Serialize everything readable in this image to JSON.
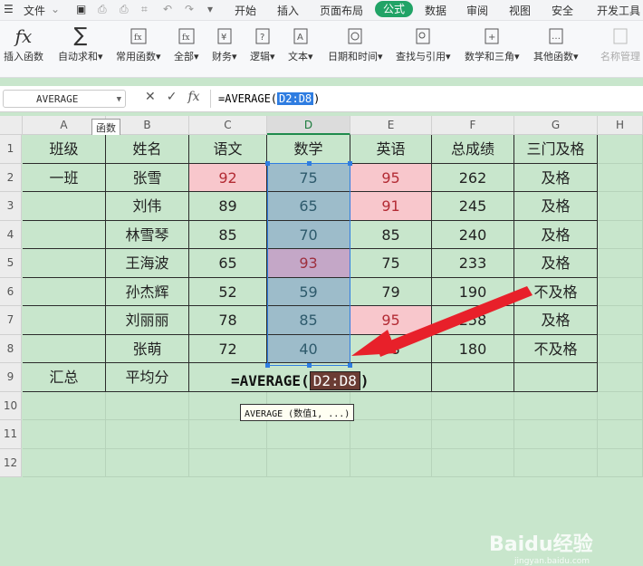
{
  "menubar": {
    "file": "文件",
    "tabs": [
      "开始",
      "插入",
      "页面布局",
      "公式",
      "数据",
      "审阅",
      "视图",
      "安全",
      "开发工具"
    ],
    "active_tab": "公式"
  },
  "ribbon": {
    "buttons": [
      {
        "label": "插入函数"
      },
      {
        "label": "自动求和▾"
      },
      {
        "label": "常用函数▾"
      },
      {
        "label": "全部▾"
      },
      {
        "label": "财务▾"
      },
      {
        "label": "逻辑▾"
      },
      {
        "label": "文本▾"
      },
      {
        "label": "日期和时间▾"
      },
      {
        "label": "查找与引用▾"
      },
      {
        "label": "数学和三角▾"
      },
      {
        "label": "其他函数▾"
      },
      {
        "label": "名称管理"
      }
    ]
  },
  "formula_bar": {
    "name_box": "AVERAGE",
    "fx": "fx",
    "formula_prefix": "=AVERAGE(",
    "formula_ref": "D2:D8",
    "formula_suffix": ")"
  },
  "fx_tooltip": "函数",
  "columns": [
    "A",
    "B",
    "C",
    "D",
    "E",
    "F",
    "G",
    "H"
  ],
  "rows": [
    "1",
    "2",
    "3",
    "4",
    "5",
    "6",
    "7",
    "8",
    "9",
    "10",
    "11",
    "12"
  ],
  "table": {
    "header": [
      "班级",
      "姓名",
      "语文",
      "数学",
      "英语",
      "总成绩",
      "三门及格"
    ],
    "data": [
      [
        "一班",
        "张雪",
        "92",
        "75",
        "95",
        "262",
        "及格"
      ],
      [
        "",
        "刘伟",
        "89",
        "65",
        "91",
        "245",
        "及格"
      ],
      [
        "",
        "林雪琴",
        "85",
        "70",
        "85",
        "240",
        "及格"
      ],
      [
        "",
        "王海波",
        "65",
        "93",
        "75",
        "233",
        "及格"
      ],
      [
        "",
        "孙杰辉",
        "52",
        "59",
        "79",
        "190",
        "不及格"
      ],
      [
        "",
        "刘丽丽",
        "78",
        "85",
        "95",
        "258",
        "及格"
      ],
      [
        "",
        "张萌",
        "72",
        "40",
        "68",
        "180",
        "不及格"
      ]
    ],
    "summary_label": "汇总",
    "avg_label": "平均分"
  },
  "cell_edit": {
    "prefix": "=AVERAGE(",
    "ref": "D2:D8",
    "suffix": ")"
  },
  "tooltip": "AVERAGE (数值1, ...)",
  "watermark": {
    "brand": "Baidu经验",
    "url": "jingyan.baidu.com"
  },
  "colors": {
    "active_tab": "#21a366",
    "selection": "#2f7de1",
    "arrow": "#e8202a",
    "pink": "#f8c7cc",
    "blue": "#9dbcca",
    "purple": "#c4a7c7"
  }
}
